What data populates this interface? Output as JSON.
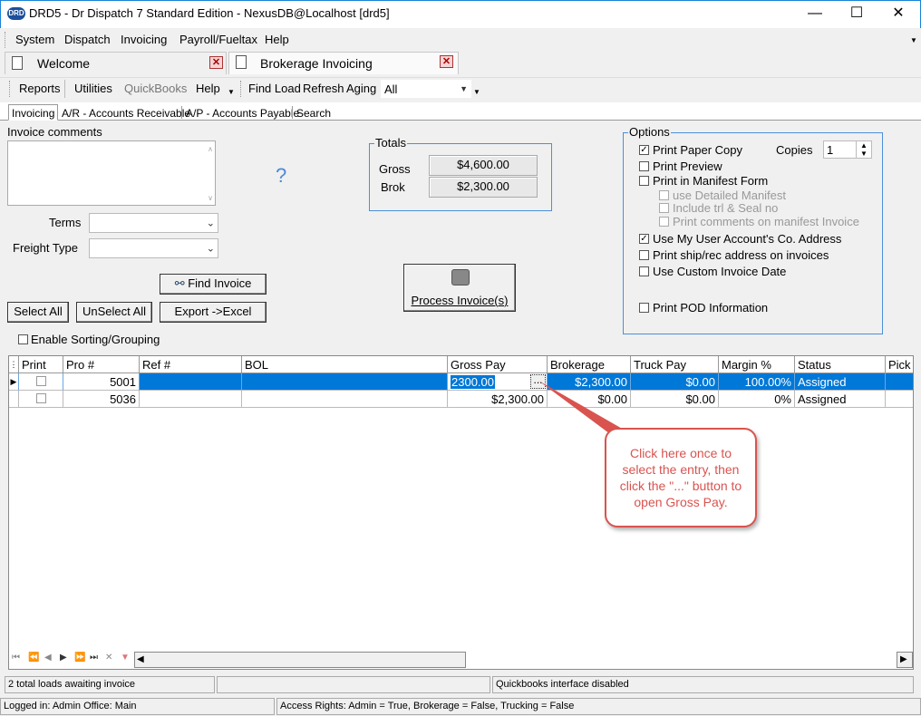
{
  "window": {
    "title": "DRD5 - Dr Dispatch 7 Standard Edition - NexusDB@Localhost [drd5]",
    "app_icon_text": "DRD",
    "minimize": "—",
    "maximize": "☐",
    "close": "✕"
  },
  "menu": [
    "System",
    "Dispatch",
    "Invoicing",
    "Payroll/Fueltax",
    "Help"
  ],
  "doc_tabs": [
    {
      "label": "Welcome"
    },
    {
      "label": "Brokerage Invoicing"
    }
  ],
  "toolbar": {
    "items": [
      "Reports",
      "Utilities",
      "QuickBooks",
      "Help",
      "Find Load",
      "Refresh",
      "Aging"
    ],
    "aging_value": "All"
  },
  "sub_tabs": [
    "Invoicing",
    "A/R - Accounts Receivable",
    "A/P - Accounts Payable",
    "Search"
  ],
  "form": {
    "invoice_comments_label": "Invoice comments",
    "help_icon": "?",
    "terms_label": "Terms",
    "terms_value": "",
    "freight_type_label": "Freight Type",
    "freight_type_value": "",
    "find_invoice": "Find Invoice",
    "select_all": "Select All",
    "unselect_all": "UnSelect All",
    "export_excel": "Export ->Excel",
    "enable_sorting": "Enable Sorting/Grouping",
    "process_invoices": "Process Invoice(s)"
  },
  "totals": {
    "legend": "Totals",
    "gross_label": "Gross",
    "gross_value": "$4,600.00",
    "brok_label": "Brok",
    "brok_value": "$2,300.00"
  },
  "options": {
    "legend": "Options",
    "copies_label": "Copies",
    "copies_value": "1",
    "items": [
      {
        "label": "Print Paper Copy",
        "checked": true,
        "enabled": true
      },
      {
        "label": "Print Preview",
        "checked": false,
        "enabled": true
      },
      {
        "label": "Print in Manifest Form",
        "checked": false,
        "enabled": true
      },
      {
        "label": "use Detailed Manifest",
        "checked": false,
        "enabled": false
      },
      {
        "label": "Include trl & Seal no",
        "checked": false,
        "enabled": false
      },
      {
        "label": "Print comments on manifest Invoice",
        "checked": false,
        "enabled": false
      },
      {
        "label": "Use My User Account's Co. Address",
        "checked": true,
        "enabled": true
      },
      {
        "label": "Print ship/rec address on invoices",
        "checked": false,
        "enabled": true
      },
      {
        "label": "Use Custom Invoice Date",
        "checked": false,
        "enabled": true
      },
      {
        "label": "Print POD Information",
        "checked": false,
        "enabled": true
      }
    ]
  },
  "grid": {
    "columns": [
      "Print",
      "Pro #",
      "Ref #",
      "BOL",
      "Gross Pay",
      "Brokerage",
      "Truck Pay",
      "Margin %",
      "Status",
      "Pick"
    ],
    "rows": [
      {
        "pro": "5001",
        "ref": "",
        "bol": "",
        "gross": "2300.00",
        "ellipsis": "...",
        "brokerage": "$2,300.00",
        "truck": "$0.00",
        "margin": "100.00%",
        "status": "Assigned"
      },
      {
        "pro": "5036",
        "ref": "",
        "bol": "",
        "gross": "$2,300.00",
        "ellipsis": "",
        "brokerage": "$0.00",
        "truck": "$0.00",
        "margin": "0%",
        "status": "Assigned"
      }
    ]
  },
  "callout": {
    "text": "Click here once to select the entry, then click the \"...\" button to open Gross Pay."
  },
  "status": {
    "left": "2 total loads awaiting invoice",
    "middle": "",
    "right": "Quickbooks interface disabled",
    "login": "Logged in: Admin Office: Main",
    "rights": "Access Rights: Admin = True, Brokerage = False, Trucking = False"
  },
  "colors": {
    "selection": "#0078d7",
    "callout": "#d9534f",
    "groupbox_border": "#4a90d9"
  }
}
